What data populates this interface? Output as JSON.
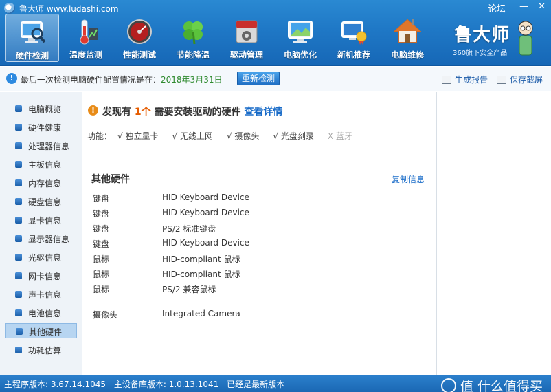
{
  "window": {
    "title": "鲁大师 www.ludashi.com",
    "forum": "论坛",
    "minimize": "—",
    "close": "✕"
  },
  "nav": {
    "items": [
      {
        "label": "硬件检测",
        "icon": "hardware-detect-icon",
        "active": true
      },
      {
        "label": "温度监测",
        "icon": "thermometer-icon"
      },
      {
        "label": "性能测试",
        "icon": "speedometer-icon"
      },
      {
        "label": "节能降温",
        "icon": "clover-icon"
      },
      {
        "label": "驱动管理",
        "icon": "driver-box-icon"
      },
      {
        "label": "电脑优化",
        "icon": "optimize-monitor-icon"
      },
      {
        "label": "新机推荐",
        "icon": "new-pc-icon"
      },
      {
        "label": "电脑维修",
        "icon": "house-repair-icon"
      }
    ]
  },
  "brand": {
    "name": "鲁大师",
    "subtitle": "360旗下安全产品"
  },
  "infobar": {
    "text": "最后一次检测电脑硬件配置情况是在：",
    "date": "2018年3月31日",
    "redetect": "重新检测",
    "report": "生成报告",
    "screenshot": "保存截屏"
  },
  "sidebar": {
    "items": [
      {
        "label": "电脑概览"
      },
      {
        "label": "硬件健康"
      },
      {
        "label": "处理器信息"
      },
      {
        "label": "主板信息"
      },
      {
        "label": "内存信息"
      },
      {
        "label": "硬盘信息"
      },
      {
        "label": "显卡信息"
      },
      {
        "label": "显示器信息"
      },
      {
        "label": "光驱信息"
      },
      {
        "label": "网卡信息"
      },
      {
        "label": "声卡信息"
      },
      {
        "label": "电池信息"
      },
      {
        "label": "其他硬件",
        "active": true
      },
      {
        "label": "功耗估算"
      }
    ]
  },
  "main": {
    "alert_prefix": "发现有",
    "alert_count": "1个",
    "alert_suffix": "需要安装驱动的硬件",
    "alert_link": "查看详情",
    "features_label": "功能：",
    "features": [
      {
        "label": "√ 独立显卡",
        "enabled": true
      },
      {
        "label": "√ 无线上网",
        "enabled": true
      },
      {
        "label": "√ 摄像头",
        "enabled": true
      },
      {
        "label": "√ 光盘刻录",
        "enabled": true
      },
      {
        "label": "X  蓝牙",
        "enabled": false
      }
    ],
    "section_title": "其他硬件",
    "copy_link": "复制信息",
    "hardware": [
      {
        "type": "键盘",
        "value": "HID Keyboard Device"
      },
      {
        "type": "键盘",
        "value": "HID Keyboard Device"
      },
      {
        "type": "键盘",
        "value": "PS/2 标准键盘"
      },
      {
        "type": "键盘",
        "value": "HID Keyboard Device"
      },
      {
        "type": "鼠标",
        "value": "HID-compliant 鼠标"
      },
      {
        "type": "鼠标",
        "value": "HID-compliant 鼠标"
      },
      {
        "type": "鼠标",
        "value": "PS/2 兼容鼠标"
      },
      {
        "type": "摄像头",
        "value": "Integrated Camera"
      }
    ]
  },
  "status": {
    "main_version": "主程序版本: 3.67.14.1045",
    "db_version": "主设备库版本: 1.0.13.1041",
    "latest": "已经是最新版本",
    "watermark": "值 什么值得买"
  },
  "colors": {
    "accent": "#1f78c6",
    "date_green": "#2f8a2f",
    "alert_orange": "#e65c00",
    "link_blue": "#1a6cc8"
  }
}
